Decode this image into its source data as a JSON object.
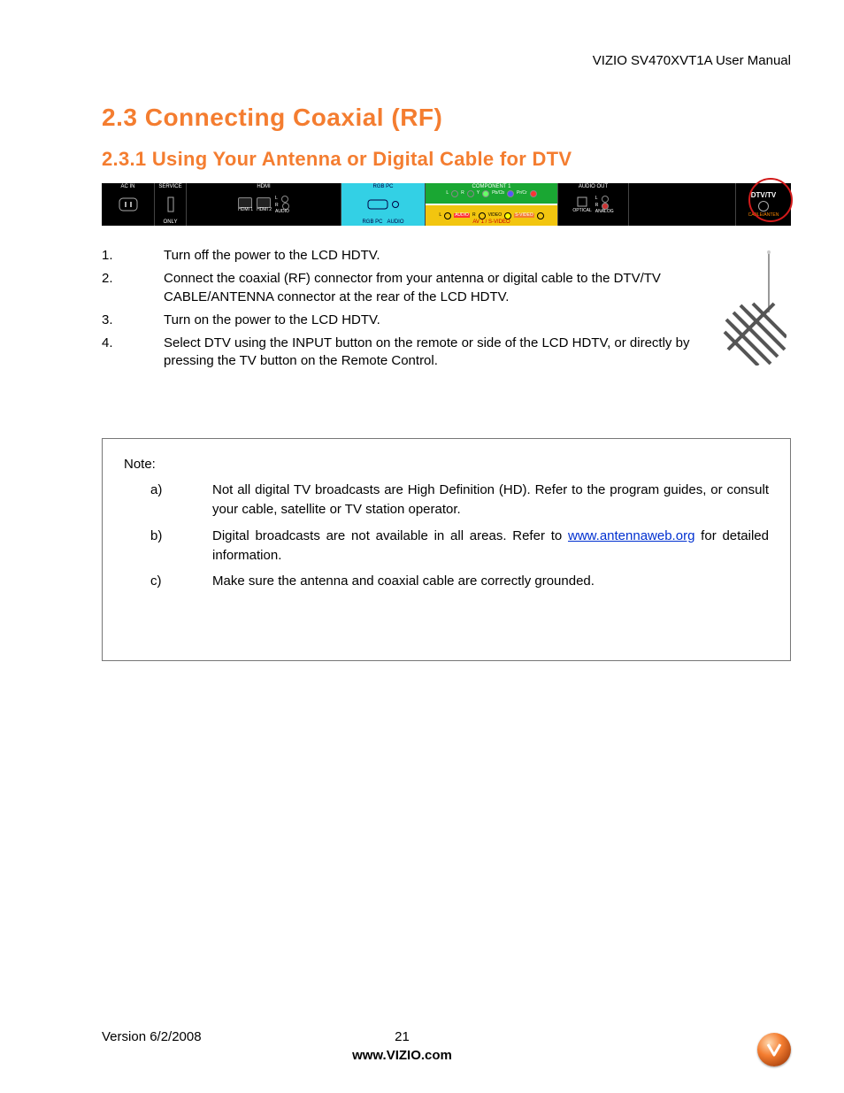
{
  "header": {
    "manual_title": "VIZIO SV470XVT1A User Manual"
  },
  "section": {
    "num_main": "2.3",
    "title_main": "Connecting Coaxial (RF)",
    "num_sub": "2.3.1",
    "title_sub": "Using Your Antenna or Digital Cable for DTV"
  },
  "panel": {
    "ac_in": "AC IN",
    "service": "SERVICE",
    "service_sub": "ONLY",
    "hdmi": "HDMI",
    "hdmi1": "HDMI 1",
    "hdmi2": "HDMI 2",
    "audio": "AUDIO",
    "l": "L",
    "r": "R",
    "rgb_pc": "RGB PC",
    "component1": "COMPONENT 1",
    "y": "Y",
    "pb": "Pb/Cb",
    "pr": "Pr/Cr",
    "video": "VIDEO",
    "av1_svideo": "AV 1 / S-VIDEO",
    "audio_out": "AUDIO OUT",
    "optical": "OPTICAL",
    "analog": "ANALOG",
    "dtv": "DTV/TV",
    "dtv_sub": "CABLE/ANTEN"
  },
  "steps": [
    {
      "n": "1.",
      "t": "Turn off the power to the LCD HDTV."
    },
    {
      "n": "2.",
      "t": "Connect the coaxial (RF) connector from your antenna or digital cable to the DTV/TV CABLE/ANTENNA connector at the rear of the LCD HDTV."
    },
    {
      "n": "3.",
      "t": "Turn on the power to the LCD HDTV."
    },
    {
      "n": "4.",
      "t": "Select DTV using the INPUT button on the remote or side of the LCD HDTV, or directly by pressing the TV button on the Remote Control."
    }
  ],
  "note": {
    "label": "Note:",
    "items": [
      {
        "l": "a)",
        "pre": "Not all digital TV broadcasts are High Definition (HD).  Refer to the program guides, or consult your cable, satellite or TV station operator."
      },
      {
        "l": "b)",
        "pre": "Digital broadcasts are not available in all areas.  Refer to ",
        "link": "www.antennaweb.org",
        "post": " for detailed information."
      },
      {
        "l": "c)",
        "pre": "Make sure the antenna and coaxial cable are correctly grounded."
      }
    ]
  },
  "footer": {
    "version": "Version 6/2/2008",
    "page": "21",
    "site": "www.VIZIO.com"
  }
}
